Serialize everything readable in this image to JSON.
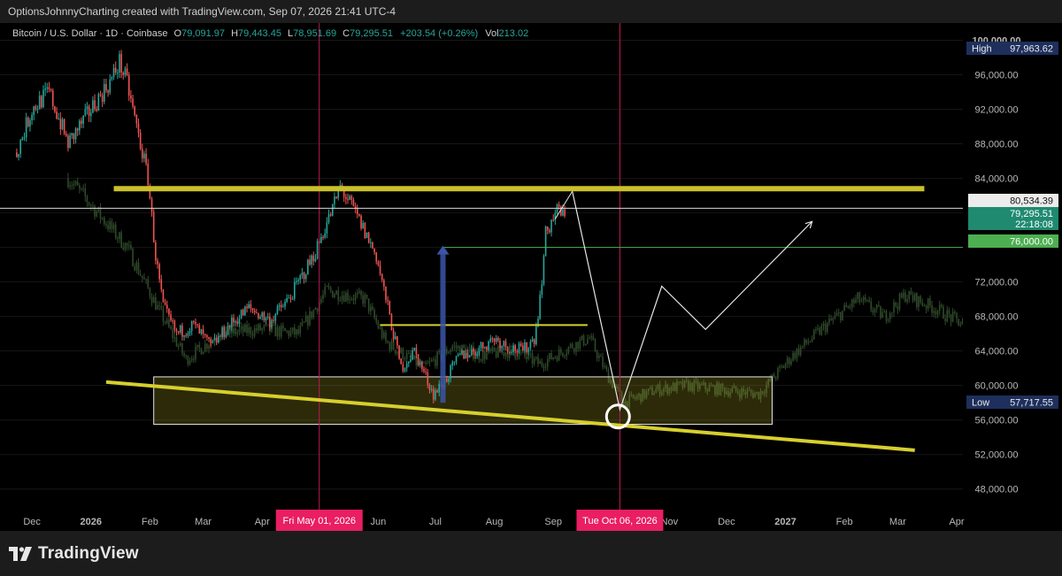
{
  "header": {
    "caption": "OptionsJohnnyCharting created with TradingView.com, Sep 07, 2026 21:41 UTC-4"
  },
  "chart_data": {
    "type": "candlestick",
    "symbol_line": {
      "symbol": "Bitcoin / U.S. Dollar · 1D · Coinbase",
      "open_label": "O",
      "open": "79,091.97",
      "high_label": "H",
      "high": "79,443.45",
      "low_label": "L",
      "low": "78,951.69",
      "close_label": "C",
      "close": "79,295.51",
      "change": "+203.54 (+0.26%)",
      "vol_label": "Vol",
      "vol": "213.02"
    },
    "y_axis": {
      "scale": "linear",
      "range": [
        45000,
        102000
      ],
      "ticks": [
        "100,000.00",
        "96,000.00",
        "92,000.00",
        "88,000.00",
        "84,000.00",
        "72,000.00",
        "68,000.00",
        "64,000.00",
        "60,000.00",
        "56,000.00",
        "52,000.00",
        "48,000.00"
      ],
      "tick_values": [
        100000,
        96000,
        92000,
        88000,
        84000,
        72000,
        68000,
        64000,
        60000,
        56000,
        52000,
        48000
      ]
    },
    "x_axis": {
      "labels": [
        {
          "text": "Dec",
          "date": "2025-12-01"
        },
        {
          "text": "2026",
          "date": "2026-01-01",
          "bold": true
        },
        {
          "text": "Feb",
          "date": "2026-02-01"
        },
        {
          "text": "Mar",
          "date": "2026-03-01"
        },
        {
          "text": "Apr",
          "date": "2026-04-01"
        },
        {
          "text": "Jun",
          "date": "2026-06-01"
        },
        {
          "text": "Jul",
          "date": "2026-07-01"
        },
        {
          "text": "Aug",
          "date": "2026-08-01"
        },
        {
          "text": "Sep",
          "date": "2026-09-01"
        },
        {
          "text": "Nov",
          "date": "2026-11-01"
        },
        {
          "text": "Dec",
          "date": "2026-12-01"
        },
        {
          "text": "2027",
          "date": "2027-01-01",
          "bold": true
        },
        {
          "text": "Feb",
          "date": "2027-02-01"
        },
        {
          "text": "Mar",
          "date": "2027-03-01"
        },
        {
          "text": "Apr",
          "date": "2027-04-01"
        }
      ],
      "highlight_labels": [
        {
          "text": "Fri May 01, 2026",
          "date": "2026-05-01"
        },
        {
          "text": "Tue Oct 06, 2026",
          "date": "2026-10-06"
        }
      ]
    },
    "price_labels": {
      "high": {
        "label": "High",
        "value": "97,963.62",
        "price": 97963.62
      },
      "low": {
        "label": "Low",
        "value": "57,717.55",
        "price": 57717.55
      },
      "white_line": {
        "value": "80,534.39",
        "price": 80534.39
      },
      "last": {
        "value": "79,295.51",
        "countdown": "22:18:08",
        "price": 79295.51
      },
      "green_level": {
        "value": "76,000.00",
        "price": 76000
      }
    },
    "series_main": {
      "description": "approximate daily close path (data units)",
      "start": "2025-11-23",
      "end": "2026-09-07",
      "anchors": [
        [
          "2025-11-23",
          87000
        ],
        [
          "2025-12-01",
          92000
        ],
        [
          "2025-12-10",
          94000
        ],
        [
          "2025-12-20",
          88000
        ],
        [
          "2026-01-01",
          92000
        ],
        [
          "2026-01-12",
          95500
        ],
        [
          "2026-01-16",
          97500
        ],
        [
          "2026-01-20",
          95000
        ],
        [
          "2026-01-26",
          89000
        ],
        [
          "2026-01-31",
          84000
        ],
        [
          "2026-02-04",
          75000
        ],
        [
          "2026-02-08",
          69000
        ],
        [
          "2026-02-15",
          66000
        ],
        [
          "2026-02-24",
          67000
        ],
        [
          "2026-03-05",
          64500
        ],
        [
          "2026-03-15",
          67000
        ],
        [
          "2026-03-25",
          69000
        ],
        [
          "2026-04-05",
          67500
        ],
        [
          "2026-04-15",
          70000
        ],
        [
          "2026-04-28",
          75000
        ],
        [
          "2026-05-08",
          80500
        ],
        [
          "2026-05-12",
          83000
        ],
        [
          "2026-05-20",
          80000
        ],
        [
          "2026-05-31",
          75000
        ],
        [
          "2026-06-05",
          70000
        ],
        [
          "2026-06-09",
          66000
        ],
        [
          "2026-06-13",
          62000
        ],
        [
          "2026-06-20",
          64000
        ],
        [
          "2026-06-30",
          59000
        ],
        [
          "2026-07-06",
          60500
        ],
        [
          "2026-07-14",
          63500
        ],
        [
          "2026-07-22",
          64000
        ],
        [
          "2026-08-01",
          65500
        ],
        [
          "2026-08-08",
          64500
        ],
        [
          "2026-08-16",
          64000
        ],
        [
          "2026-08-22",
          65500
        ],
        [
          "2026-08-25",
          70000
        ],
        [
          "2026-08-28",
          77500
        ],
        [
          "2026-09-01",
          79500
        ],
        [
          "2026-09-04",
          80500
        ],
        [
          "2026-09-07",
          79295.51
        ]
      ]
    },
    "series_ghost": {
      "description": "faded earlier-cycle overlay (data units)",
      "start": "2025-12-20",
      "end": "2027-04-09",
      "anchors": [
        [
          "2025-12-20",
          84000
        ],
        [
          "2025-12-28",
          82000
        ],
        [
          "2026-01-20",
          76000
        ],
        [
          "2026-02-05",
          69000
        ],
        [
          "2026-02-20",
          63000
        ],
        [
          "2026-03-10",
          66000
        ],
        [
          "2026-03-31",
          66500
        ],
        [
          "2026-04-20",
          66000
        ],
        [
          "2026-05-05",
          71000
        ],
        [
          "2026-05-25",
          70000
        ],
        [
          "2026-06-05",
          65000
        ],
        [
          "2026-06-25",
          62000
        ],
        [
          "2026-07-10",
          64500
        ],
        [
          "2026-07-25",
          63500
        ],
        [
          "2026-08-10",
          64000
        ],
        [
          "2026-08-25",
          62500
        ],
        [
          "2026-09-10",
          64500
        ],
        [
          "2026-09-20",
          65500
        ],
        [
          "2026-09-30",
          61000
        ],
        [
          "2026-10-08",
          58000
        ],
        [
          "2026-10-25",
          59500
        ],
        [
          "2026-11-10",
          60000
        ],
        [
          "2026-11-30",
          59500
        ],
        [
          "2026-12-18",
          59000
        ],
        [
          "2027-01-05",
          63500
        ],
        [
          "2027-01-20",
          66500
        ],
        [
          "2027-02-08",
          70000
        ],
        [
          "2027-02-22",
          68000
        ],
        [
          "2027-03-05",
          70500
        ],
        [
          "2027-03-20",
          69000
        ],
        [
          "2027-04-05",
          67000
        ],
        [
          "2027-04-09",
          63000
        ]
      ]
    },
    "annotations": {
      "resistance_line": {
        "from": [
          "2026-01-13",
          82800
        ],
        "to": [
          "2027-03-15",
          82800
        ],
        "color": "#c9c02a"
      },
      "horizontal_mid": {
        "from": [
          "2026-06-02",
          67000
        ],
        "to": [
          "2026-09-19",
          67000
        ],
        "color": "#d7cf2d"
      },
      "green_ray": {
        "from": [
          "2026-07-05",
          76000
        ],
        "price": 76000,
        "color": "#4caf50"
      },
      "white_ray": {
        "price": 80534.39,
        "color": "#d9d9d9"
      },
      "descending_trendline": {
        "from": [
          "2026-01-09",
          60400
        ],
        "to": [
          "2027-03-10",
          52500
        ],
        "color": "#d7cf2d"
      },
      "support_box": {
        "from": [
          "2026-02-03",
          61000
        ],
        "to": [
          "2026-12-25",
          55500
        ],
        "color": "#c9c02a"
      },
      "target_circle": {
        "center": [
          "2026-10-05",
          56400
        ],
        "color": "#ffffff"
      },
      "blue_arrow": {
        "from": [
          "2026-07-05",
          58000
        ],
        "to": [
          "2026-07-05",
          76200
        ],
        "color": "#3a55a8"
      },
      "vertical_lines": [
        {
          "date": "2026-05-01",
          "color": "#c2185b"
        },
        {
          "date": "2026-10-06",
          "color": "#c2185b"
        }
      ],
      "projection_path": [
        [
          "2026-09-11",
          82500
        ],
        [
          "2026-10-06",
          57200
        ],
        [
          "2026-10-28",
          71500
        ],
        [
          "2026-11-20",
          66500
        ],
        [
          "2027-01-15",
          79000
        ]
      ],
      "channel_line": {
        "from": [
          "2026-09-02",
          79300
        ],
        "to": [
          "2026-09-11",
          82500
        ]
      },
      "green_bar": {
        "date": "2027-04-12",
        "from": 66000,
        "to": 70000,
        "color": "#4caf50"
      },
      "green_bar_small": {
        "date": "2027-04-09",
        "from": 61500,
        "to": 69500,
        "color": "#4caf50"
      }
    },
    "colors": {
      "up": "#26a69a",
      "down": "#ef5350",
      "ghost": "#2f4a2a",
      "accent_magenta": "#e91e63",
      "high_low_bg": "#1e2f5c",
      "last_bg": "#1f8a70",
      "green_label": "#4caf50"
    }
  },
  "footer": {
    "logo_text": "TradingView"
  }
}
